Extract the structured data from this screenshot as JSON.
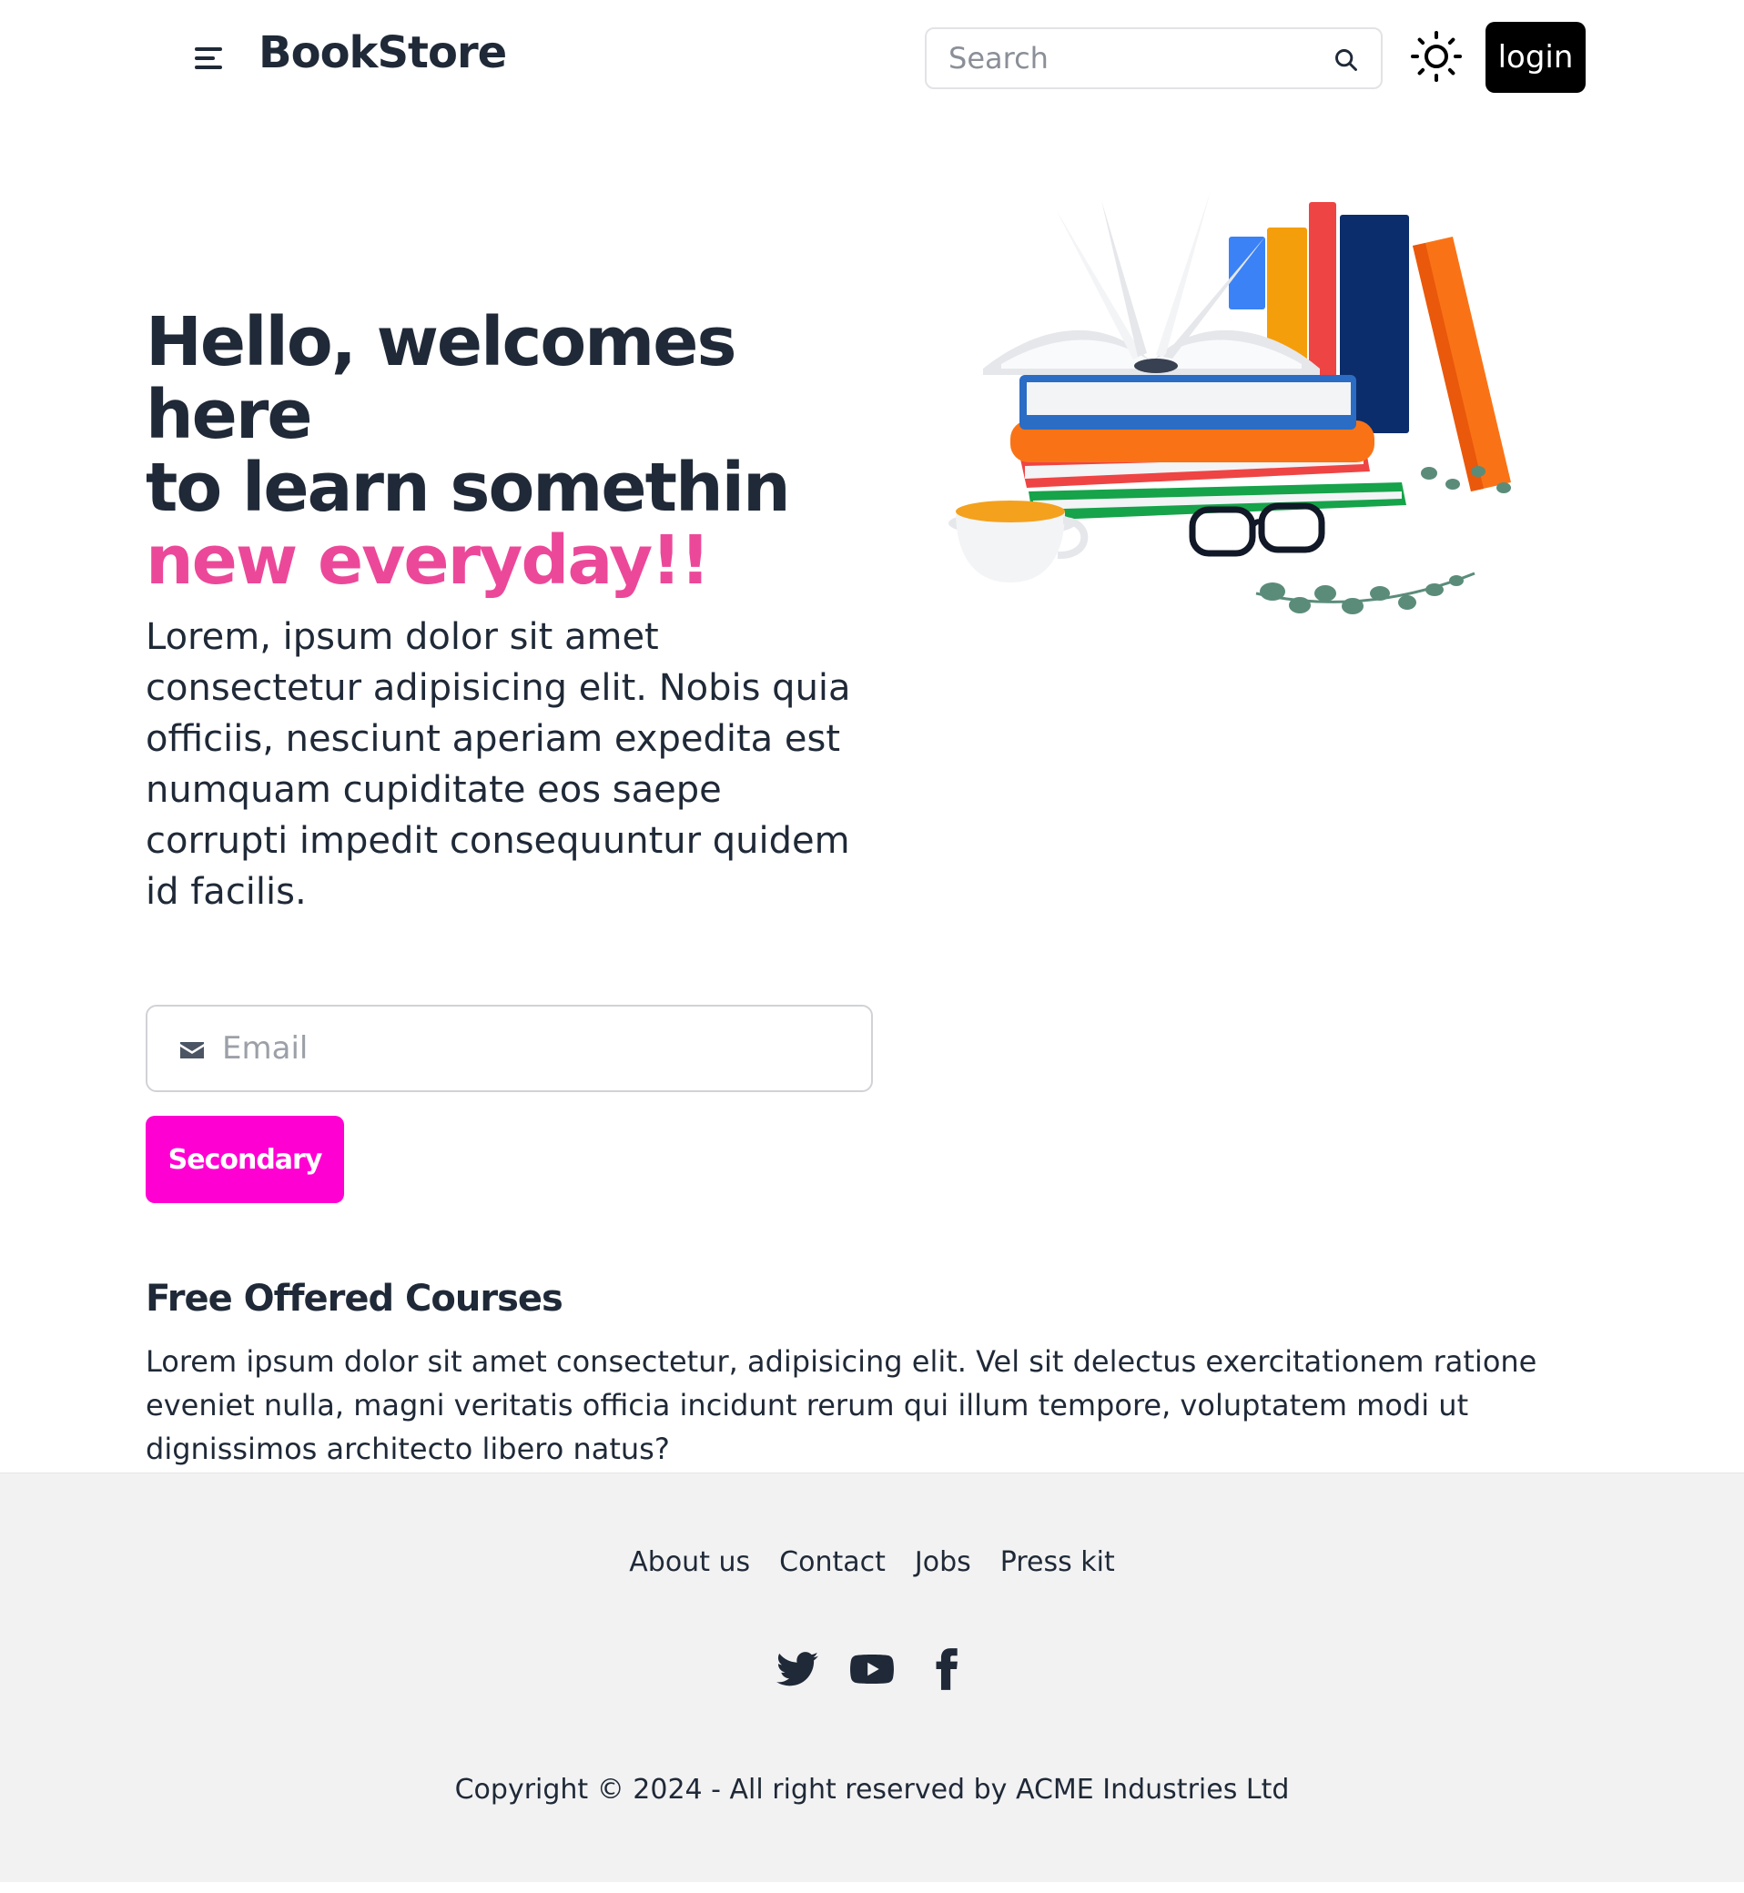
{
  "header": {
    "brand": "BookStore",
    "search_placeholder": "Search",
    "login_label": "login"
  },
  "hero": {
    "title_line1": "Hello, welcomes here",
    "title_line2": "to learn somethin",
    "title_accent": "new everyday!!",
    "description": "Lorem, ipsum dolor sit amet consectetur adipisicing elit. Nobis quia officiis, nesciunt aperiam expedita est numquam cupiditate eos saepe corrupti impedit consequuntur quidem id facilis.",
    "email_placeholder": "Email",
    "button_label": "Secondary"
  },
  "courses": {
    "title": "Free Offered Courses",
    "description": "Lorem ipsum dolor sit amet consectetur, adipisicing elit. Vel sit delectus exercitationem ratione eveniet nulla, magni veritatis officia incidunt rerum qui illum tempore, voluptatem modi ut dignissimos architecto libero natus?"
  },
  "footer": {
    "links": [
      "About us",
      "Contact",
      "Jobs",
      "Press kit"
    ],
    "social_icons": [
      "twitter-icon",
      "youtube-icon",
      "facebook-icon"
    ],
    "copyright": "Copyright © 2024 - All right reserved by ACME Industries Ltd"
  },
  "colors": {
    "accent_pink": "#ec4899",
    "button_magenta": "#ff00d3",
    "login_bg": "#000000",
    "footer_bg": "#f2f2f3"
  }
}
